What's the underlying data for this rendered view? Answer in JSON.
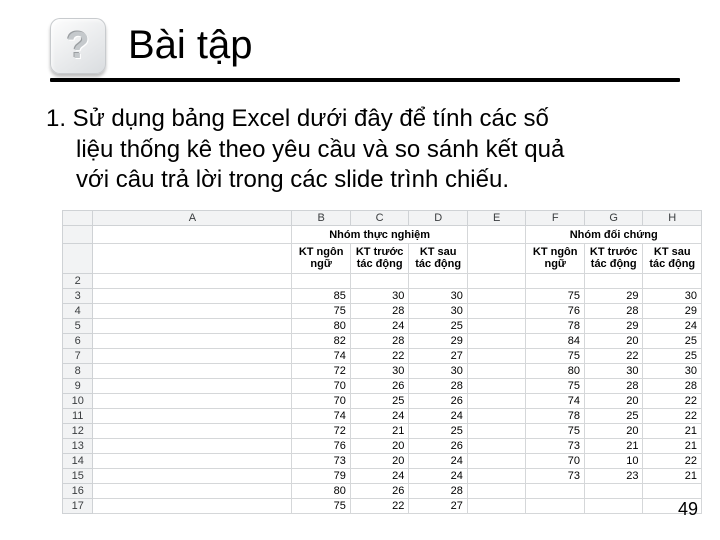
{
  "title": "Bài tập",
  "body_line1": "1. Sử dụng bảng Excel dưới đây để tính các số",
  "body_line2": "liệu thống kê theo yêu cầu và so sánh kết quả",
  "body_line3": "với câu trả lời trong các slide trình chiếu.",
  "cols": [
    "A",
    "B",
    "C",
    "D",
    "E",
    "F",
    "G",
    "H"
  ],
  "group1": "Nhóm thực nghiệm",
  "group2": "Nhóm đối chứng",
  "sub": [
    "KT ngôn ngữ",
    "KT trước tác động",
    "KT sau tác động",
    "",
    "KT ngôn ngữ",
    "KT trước tác động",
    "KT sau tác động"
  ],
  "row_start": 2,
  "rows": [
    [
      null,
      null,
      null,
      null,
      null,
      null,
      null
    ],
    [
      85,
      30,
      30,
      null,
      75,
      29,
      30
    ],
    [
      75,
      28,
      30,
      null,
      76,
      28,
      29
    ],
    [
      80,
      24,
      25,
      null,
      78,
      29,
      24
    ],
    [
      82,
      28,
      29,
      null,
      84,
      20,
      25
    ],
    [
      74,
      22,
      27,
      null,
      75,
      22,
      25
    ],
    [
      72,
      30,
      30,
      null,
      80,
      30,
      30
    ],
    [
      70,
      26,
      28,
      null,
      75,
      28,
      28
    ],
    [
      70,
      25,
      26,
      null,
      74,
      20,
      22
    ],
    [
      74,
      24,
      24,
      null,
      78,
      25,
      22
    ],
    [
      72,
      21,
      25,
      null,
      75,
      20,
      21
    ],
    [
      76,
      20,
      26,
      null,
      73,
      21,
      21
    ],
    [
      73,
      20,
      24,
      null,
      70,
      10,
      22
    ],
    [
      79,
      24,
      24,
      null,
      73,
      23,
      21
    ],
    [
      80,
      26,
      28,
      null,
      null,
      null,
      null
    ],
    [
      75,
      22,
      27,
      null,
      null,
      null,
      null
    ]
  ],
  "page_number": "49",
  "qmark": "?"
}
